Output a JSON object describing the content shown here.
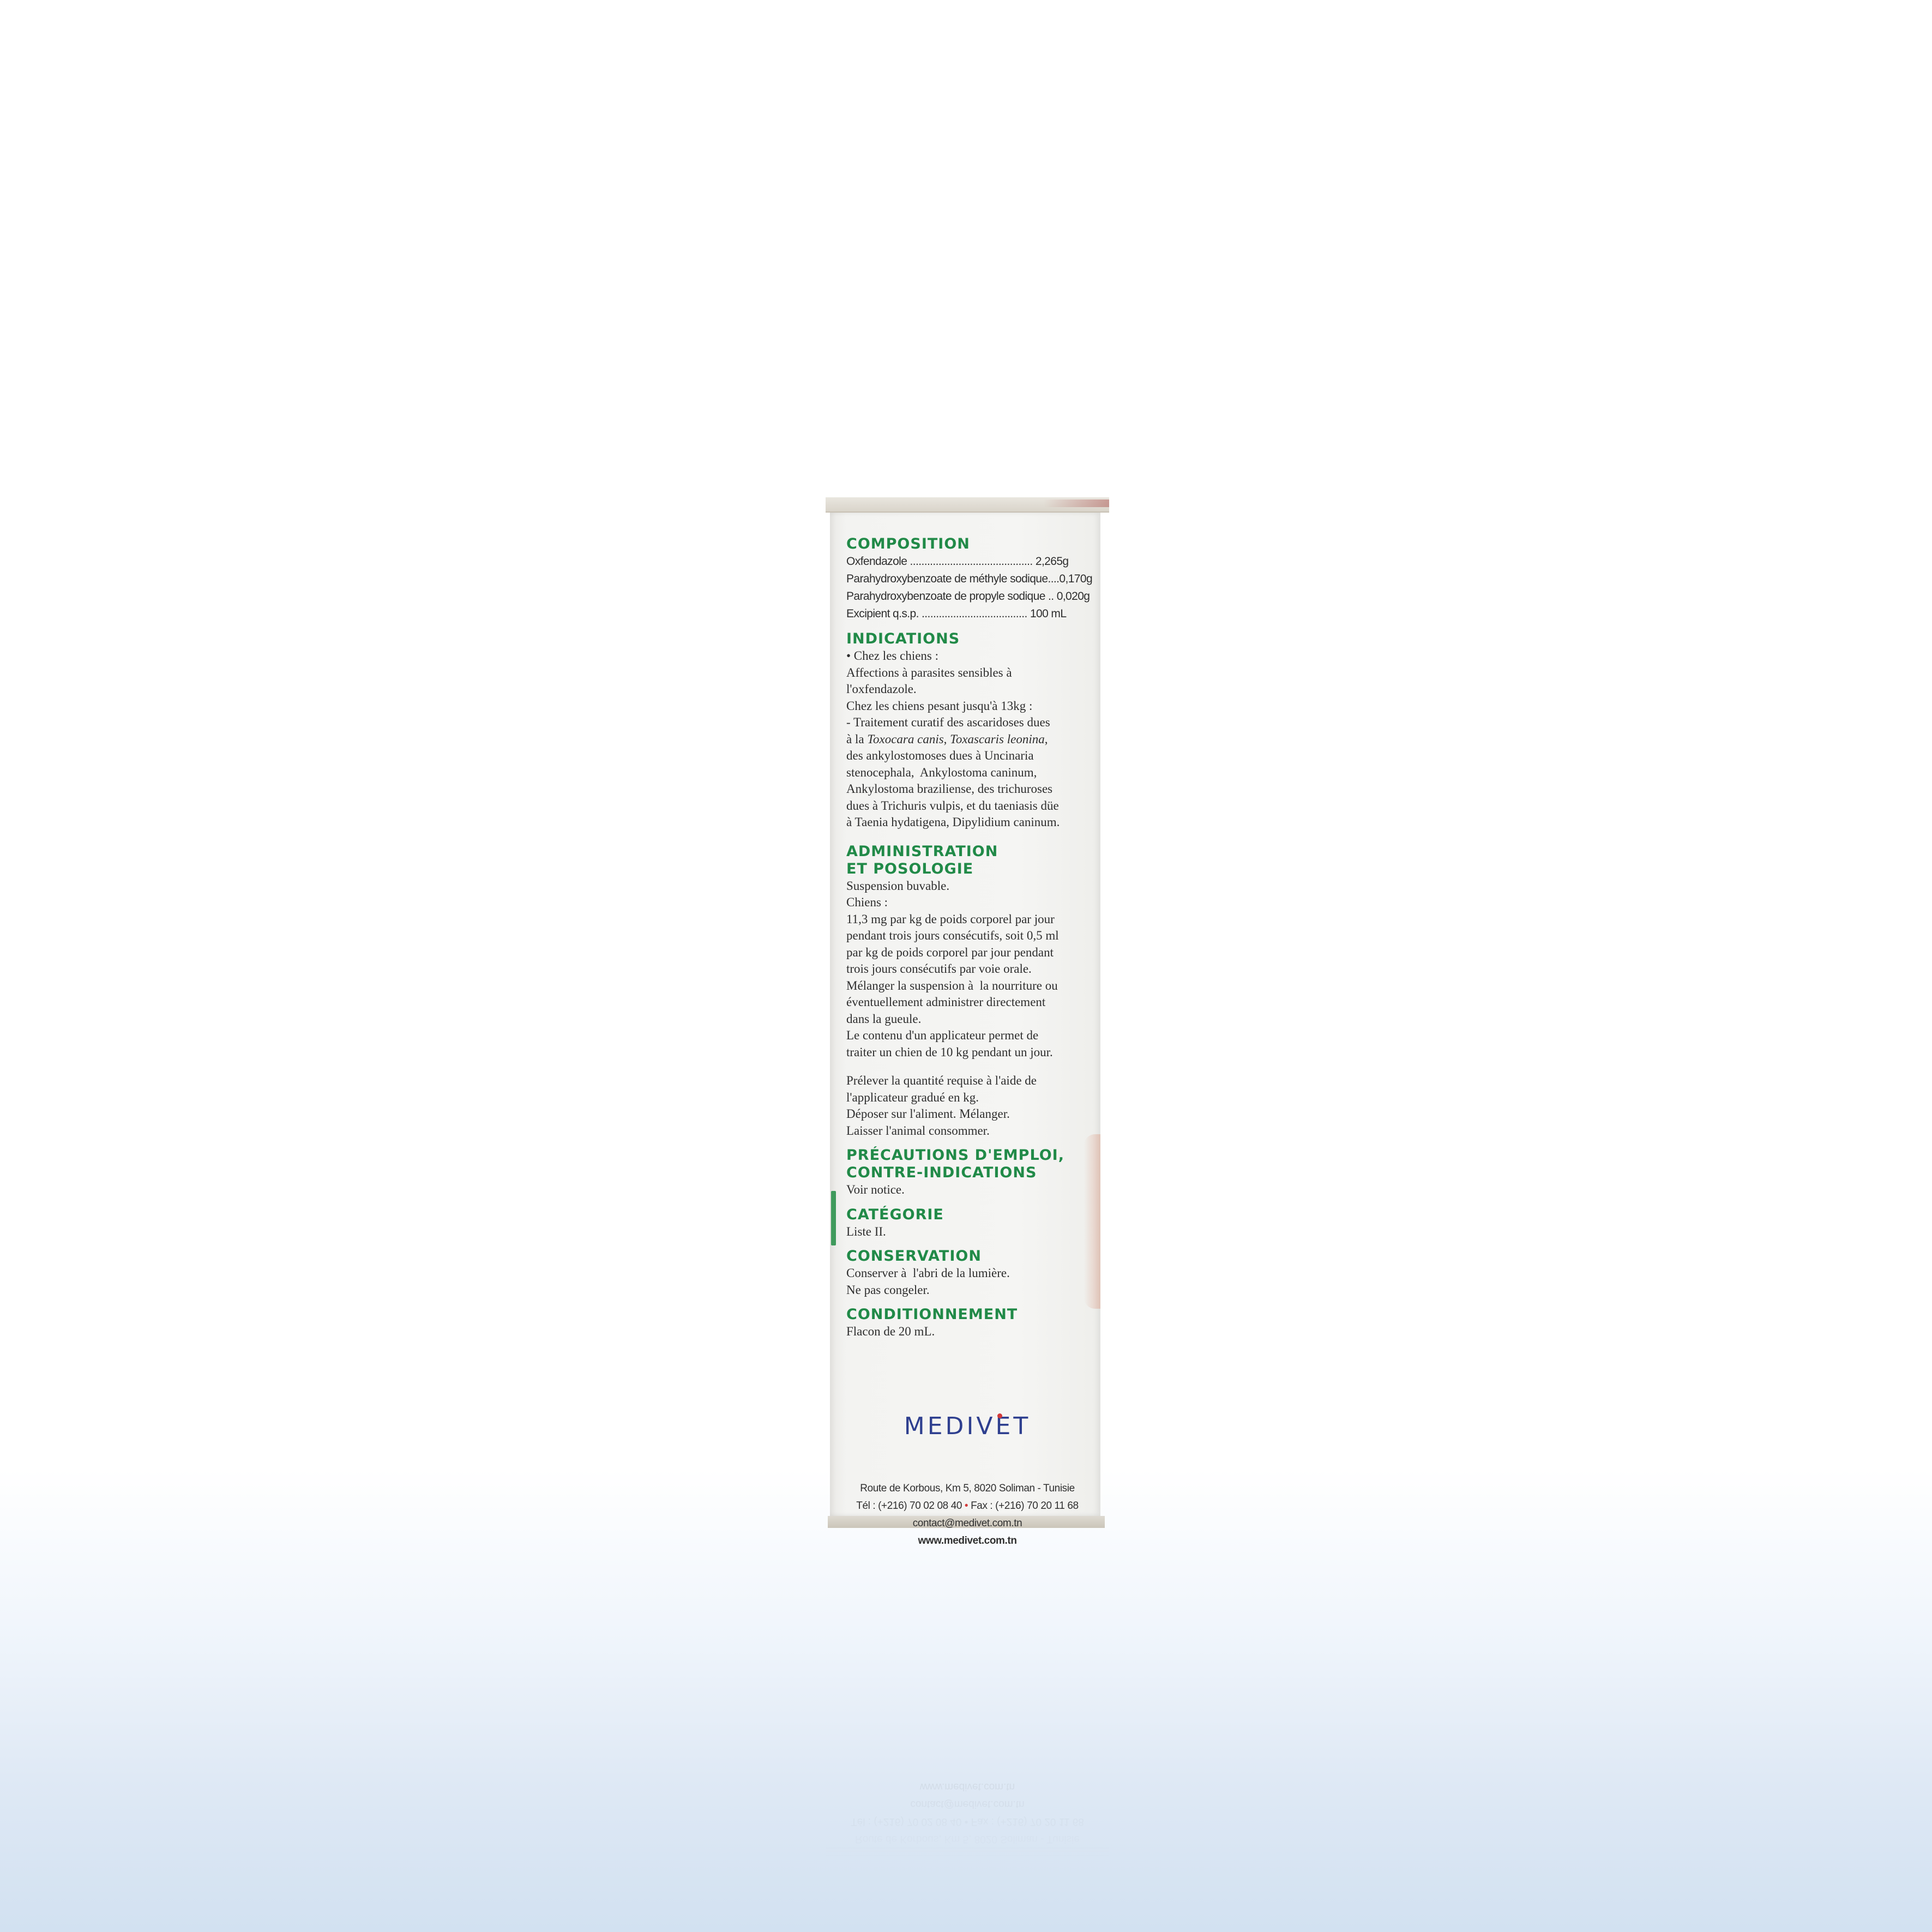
{
  "composition": {
    "heading": "COMPOSITION",
    "rows": [
      "Oxfendazole ........................................... 2,265g",
      "Parahydroxybenzoate de méthyle sodique....0,170g",
      "Parahydroxybenzoate de propyle sodique .. 0,020g",
      "Excipient q.s.p. ..................................... 100 mL"
    ]
  },
  "indications": {
    "heading": "INDICATIONS",
    "line1": "• Chez les chiens :",
    "line2": "Affections à parasites sensibles à\nl'oxfendazole.",
    "line3": "Chez les chiens pesant jusqu'à 13kg :",
    "line4_start": "- Traitement curatif des ascaridoses dues\nà la ",
    "species1": "Toxocara canis",
    "sep1": ", ",
    "species2": "Toxascaris leonina",
    "line4_end": ",\ndes ankylostomoses dues à Uncinaria\nstenocephala,  Ankylostoma caninum,\nAnkylostoma braziliense, des trichuroses\ndues à Trichuris vulpis, et du taeniasis düe\nà Taenia hydatigena, Dipylidium caninum."
  },
  "administration": {
    "heading1": "ADMINISTRATION",
    "heading2": "ET POSOLOGIE",
    "body1": "Suspension buvable.\nChiens :\n11,3 mg par kg de poids corporel par jour\npendant trois jours consécutifs, soit 0,5 ml\npar kg de poids corporel par jour pendant\ntrois jours consécutifs par voie orale.\nMélanger la suspension à  la nourriture ou\néventuellement administrer directement\ndans la gueule.\nLe contenu d'un applicateur permet de\ntraiter un chien de 10 kg pendant un jour.",
    "body2": "Prélever la quantité requise à l'aide de\nl'applicateur gradué en kg.\nDéposer sur l'aliment. Mélanger.\nLaisser l'animal consommer."
  },
  "precautions": {
    "heading1": "PRÉCAUTIONS D'EMPLOI,",
    "heading2": "CONTRE-INDICATIONS",
    "body": "Voir notice."
  },
  "categorie": {
    "heading": "CATÉGORIE",
    "body": "Liste II."
  },
  "conservation": {
    "heading": "CONSERVATION",
    "body": "Conserver à  l'abri de la lumière.\nNe pas congeler."
  },
  "conditionnement": {
    "heading": "CONDITIONNEMENT",
    "body": "Flacon de 20 mL."
  },
  "brand": {
    "logo": "MEDIVET",
    "address": "Route de Korbous, Km 5, 8020 Soliman - Tunisie",
    "tel": "Tél : (+216) 70 02 08 40",
    "bullet": "•",
    "fax": "Fax : (+216) 70 20 11 68",
    "email": "contact@medivet.com.tn",
    "website": "www.medivet.com.tn"
  },
  "colors": {
    "heading_green": "#218a48",
    "logo_blue": "#2e3f8f",
    "accent_red": "#d23a3a"
  }
}
